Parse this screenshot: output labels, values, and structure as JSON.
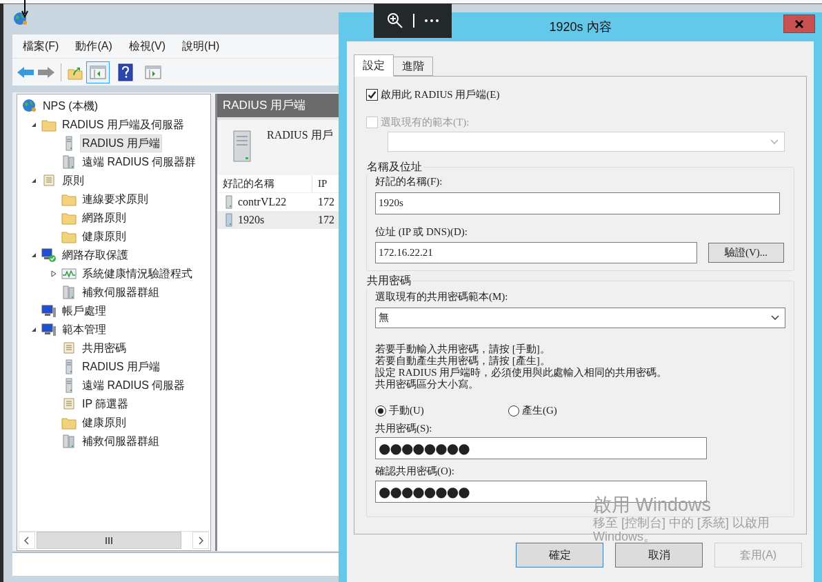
{
  "console": {
    "menu": [
      "檔案(F)",
      "動作(A)",
      "檢視(V)",
      "說明(H)"
    ],
    "toolbar": [
      {
        "kind": "back",
        "disabled": false
      },
      {
        "kind": "forward",
        "disabled": true
      },
      {
        "kind": "separator"
      },
      {
        "kind": "up",
        "disabled": false
      },
      {
        "kind": "tree",
        "pressed": true
      },
      {
        "kind": "help",
        "disabled": false
      },
      {
        "kind": "action-pane",
        "pressed": false
      }
    ],
    "tree": [
      {
        "label": "NPS (本機)",
        "kind": "globe",
        "selected": false,
        "children": [
          {
            "label": "RADIUS 用戶端及伺服器",
            "kind": "folder",
            "selected": false,
            "expanded": true,
            "children": [
              {
                "label": "RADIUS 用戶端",
                "kind": "server",
                "selected": true
              },
              {
                "label": "遠端 RADIUS 伺服器群",
                "kind": "server-group",
                "selected": false
              }
            ]
          },
          {
            "label": "原則",
            "kind": "scroll",
            "selected": false,
            "expanded": true,
            "children": [
              {
                "label": "連線要求原則",
                "kind": "folder",
                "selected": false
              },
              {
                "label": "網路原則",
                "kind": "folder",
                "selected": false
              },
              {
                "label": "健康原則",
                "kind": "folder",
                "selected": false
              }
            ]
          },
          {
            "label": "網路存取保護",
            "kind": "shield-computer",
            "selected": false,
            "expanded": true,
            "children": [
              {
                "label": "系統健康情況驗證程式",
                "kind": "chart",
                "selected": false,
                "expanded": false
              },
              {
                "label": "補救伺服器群組",
                "kind": "server-group",
                "selected": false
              }
            ]
          },
          {
            "label": "帳戶處理",
            "kind": "computer",
            "selected": false
          },
          {
            "label": "範本管理",
            "kind": "computer",
            "selected": false,
            "expanded": true,
            "children": [
              {
                "label": "共用密碼",
                "kind": "scroll",
                "selected": false
              },
              {
                "label": "RADIUS 用戶端",
                "kind": "server",
                "selected": false
              },
              {
                "label": "遠端 RADIUS 伺服器",
                "kind": "server",
                "selected": false
              },
              {
                "label": "IP 篩選器",
                "kind": "scroll",
                "selected": false
              },
              {
                "label": "健康原則",
                "kind": "folder",
                "selected": false
              },
              {
                "label": "補救伺服器群組",
                "kind": "server-group",
                "selected": false
              }
            ]
          }
        ]
      }
    ],
    "pane_title": "RADIUS 用戶端",
    "pane_description": "RADIUS 用戶",
    "list": {
      "columns": [
        "好記的名稱",
        "IP"
      ],
      "rows": [
        {
          "cells": [
            "contrVL22",
            "172"
          ],
          "selected": false
        },
        {
          "cells": [
            "1920s",
            "172"
          ],
          "selected": true
        }
      ]
    }
  },
  "dialog": {
    "title": "1920s 內容",
    "tabs": [
      {
        "label": "設定",
        "selected": true
      },
      {
        "label": "進階",
        "selected": false
      }
    ],
    "enable_client": {
      "label": "啟用此 RADIUS 用戶端(E)",
      "checked": true
    },
    "use_template": {
      "label": "選取現有的範本(T):",
      "checked": false,
      "disabled": true
    },
    "name_address": {
      "legend": "名稱及位址",
      "name_label": "好記的名稱(F):",
      "name_value": "1920s",
      "address_label": "位址 (IP 或 DNS)(D):",
      "address_value": "172.16.22.21",
      "verify_button": "驗證(V)..."
    },
    "shared_secret": {
      "legend": "共用密碼",
      "template_label": "選取現有的共用密碼範本(M):",
      "template_value": "無",
      "help_lines": [
        "若要手動輸入共用密碼，請按 [手動]。",
        "若要自動產生共用密碼，請按 [產生]。",
        "設定 RADIUS 用戶端時，必須使用與此處輸入相同的共用密碼。",
        "共用密碼區分大小寫。"
      ],
      "modes": [
        {
          "label": "手動(U)",
          "selected": true
        },
        {
          "label": "產生(G)",
          "selected": false
        }
      ],
      "secret_label": "共用密碼(S):",
      "secret_value": "●●●●●●●●",
      "confirm_label": "確認共用密碼(O):",
      "confirm_value": "●●●●●●●●"
    },
    "buttons": [
      {
        "label": "確定",
        "default": true,
        "disabled": false
      },
      {
        "label": "取消",
        "default": false,
        "disabled": false
      },
      {
        "label": "套用(A)",
        "default": false,
        "disabled": true
      }
    ]
  },
  "activation_notice": {
    "title": "啟用 Windows",
    "message": "移至 [控制台] 中的 [系統] 以啟用 Windows。"
  }
}
